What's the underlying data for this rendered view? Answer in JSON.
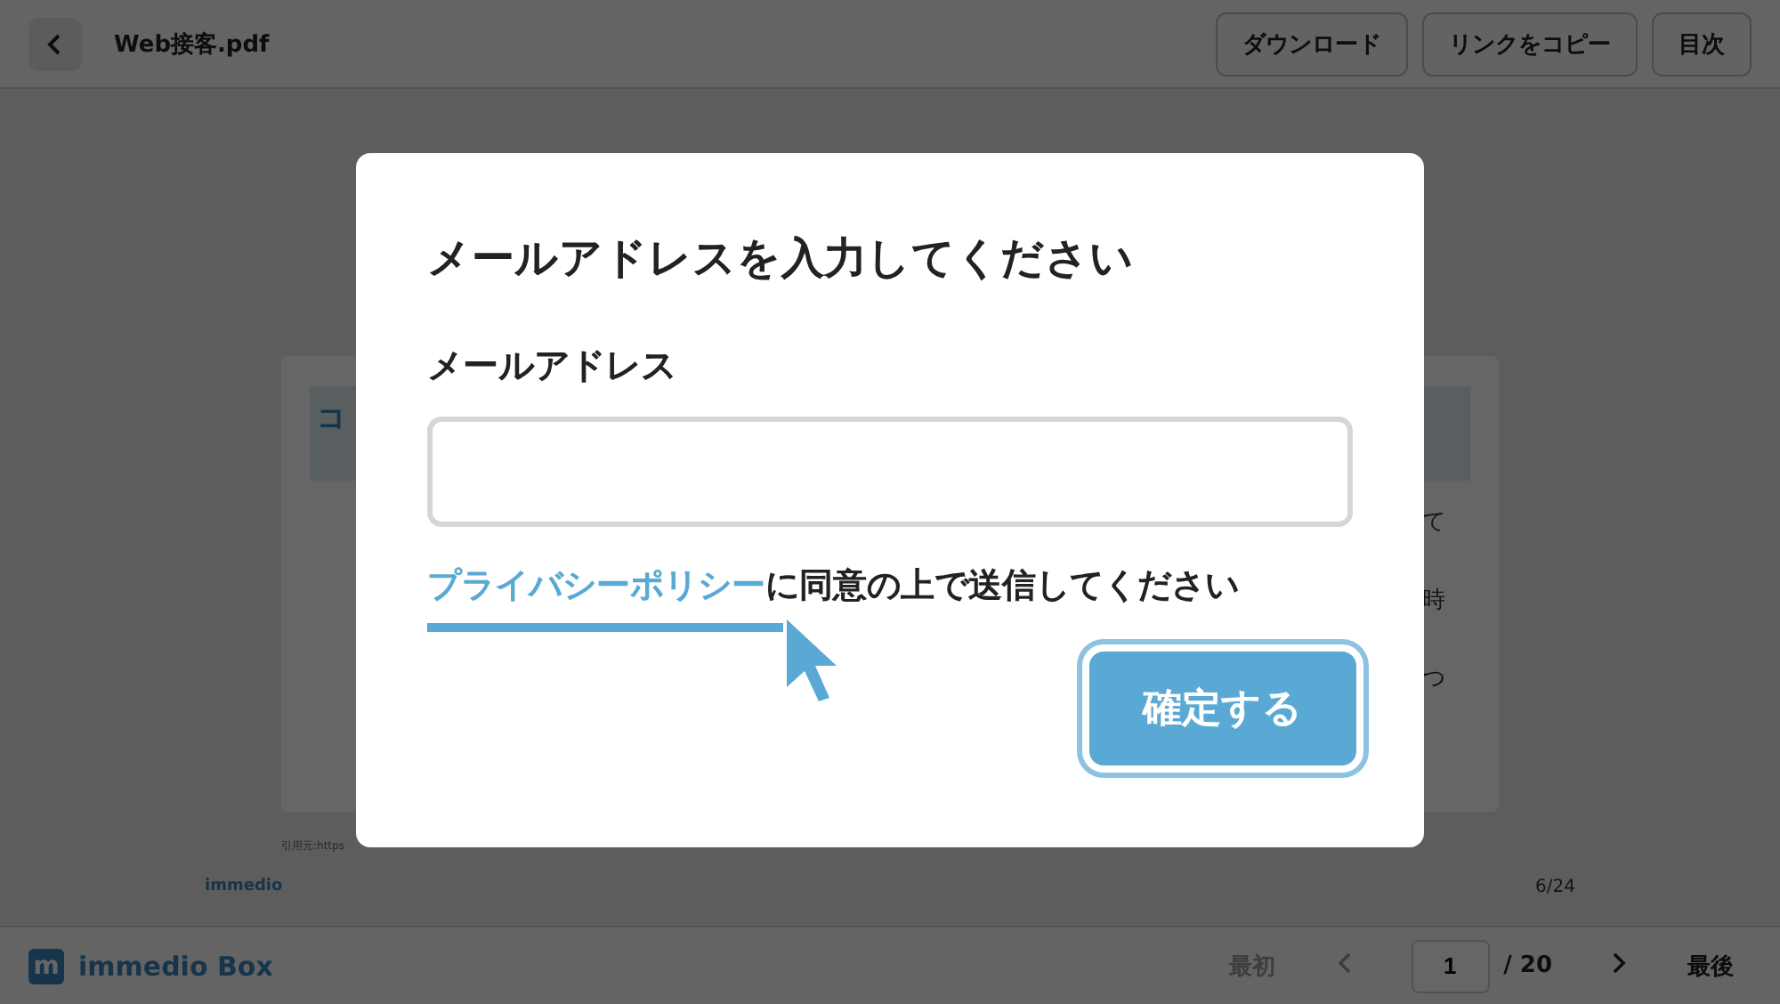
{
  "header": {
    "file_name": "Web接客.pdf",
    "buttons": [
      "ダウンロード",
      "リンクをコピー",
      "目次"
    ]
  },
  "document": {
    "heading_fragment": "コ",
    "line_fragments": [
      "て",
      "時",
      "つ"
    ],
    "source_note": "引用元:https",
    "logo": "immedio",
    "page_number": "6/24"
  },
  "modal": {
    "title": "メールアドレスを入力してください",
    "field_label": "メールアドレス",
    "consent": {
      "link": "プライバシーポリシー",
      "text": "に同意の上で送信してください"
    },
    "submit": "確定する"
  },
  "footer": {
    "brand": "immedio Box",
    "logo_letter": "m",
    "pagination": {
      "first": {
        "label": "最初",
        "disabled": true
      },
      "prev_disabled": true,
      "page": "1",
      "total": "/ 20",
      "next_disabled": false,
      "last": {
        "label": "最後",
        "disabled": false
      }
    }
  }
}
